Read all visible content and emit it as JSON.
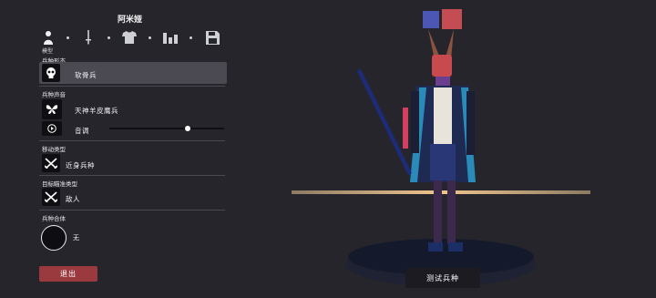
{
  "header": {
    "title": "阿米娅"
  },
  "tabs": {
    "items": [
      {
        "name": "unit-tab",
        "icon": "person-icon"
      },
      {
        "name": "weapon-tab",
        "icon": "sword-icon"
      },
      {
        "name": "clothing-tab",
        "icon": "shirt-icon"
      },
      {
        "name": "stats-tab",
        "icon": "bar-chart-icon"
      },
      {
        "name": "save-tab",
        "icon": "floppy-disk-icon"
      }
    ],
    "active_caption": "模型"
  },
  "sections": {
    "appearance": {
      "label": "兵种形态",
      "value": "软骨兵",
      "icon": "skull-icon"
    },
    "voice": {
      "label": "兵种声音",
      "value": "天神羊皮鹰兵",
      "icon": "butterfly-icon",
      "pitch_label": "音调",
      "pitch_level": 0.68
    },
    "movement": {
      "label": "移动类型",
      "value": "近身兵种",
      "icon": "crossed-swords-icon"
    },
    "targeting": {
      "label": "目标瞄准类型",
      "value": "敌人",
      "icon": "crossed-swords-icon"
    },
    "merge": {
      "label": "兵种合体",
      "value": "无"
    }
  },
  "buttons": {
    "exit": "退出",
    "test": "测试兵种"
  },
  "colors": {
    "exit_button": "#9b3a3e",
    "selected_row": "#4b4a53",
    "background": "#26252c",
    "horizon": "#f0c48c"
  }
}
